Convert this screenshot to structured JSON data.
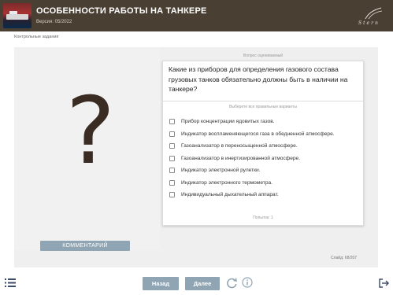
{
  "header": {
    "title": "ОСОБЕННОСТИ РАБОТЫ НА ТАНКЕРЕ",
    "version": "Версия: 05/2022",
    "logo_text": "Stern",
    "background_color": "#4a3f33"
  },
  "breadcrumb": "Контрольные задания",
  "question_panel": {
    "status": "Вопрос оцениваемый",
    "question": "Какие из приборов для определения газового состава грузовых танков обязательно должны быть в наличии на танкере?",
    "select_hint": "Выберите все правильные варианты",
    "options": [
      {
        "label": "Прибор концентрации ядовитых газов.",
        "checked": false
      },
      {
        "label": "Индикатор воспламеняющегося газа в обедненной атмосфере.",
        "checked": false
      },
      {
        "label": "Газоанализатор в переносыщенной атмосфере.",
        "checked": false
      },
      {
        "label": "Газоанализатор в инертизированной атмосфере.",
        "checked": false
      },
      {
        "label": "Индикатор электронной рулетки.",
        "checked": false
      },
      {
        "label": "Индикатор электронного термометра.",
        "checked": false
      },
      {
        "label": "Индивидуальный дыхательный аппарат.",
        "checked": false
      }
    ],
    "attempts": "Попыток: 1"
  },
  "left_panel": {
    "symbol": "?",
    "comment_button": "КОММЕНТАРИЙ"
  },
  "slide_counter": "Слайд: 68/207",
  "footer": {
    "back_label": "Назад",
    "next_label": "Далее",
    "icons": [
      "menu-icon",
      "reload-icon",
      "info-icon",
      "exit-icon"
    ],
    "button_color": "#8fa5b3"
  }
}
